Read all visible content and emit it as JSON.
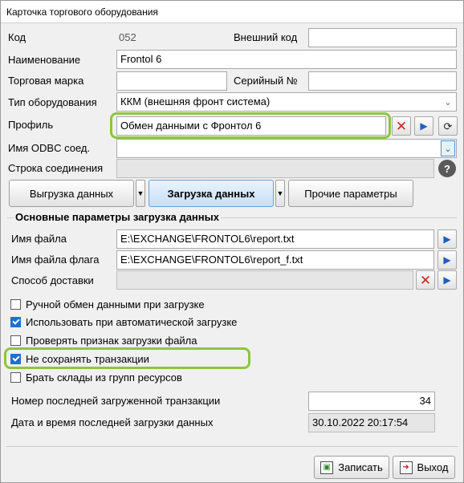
{
  "window": {
    "title": "Карточка торгового оборудования"
  },
  "fields": {
    "code_label": "Код",
    "code_value": "052",
    "external_code_label": "Внешний код",
    "external_code_value": "",
    "name_label": "Наименование",
    "name_value": "Frontol 6",
    "brand_label": "Торговая марка",
    "brand_value": "",
    "serial_label": "Серийный №",
    "serial_value": "",
    "type_label": "Тип оборудования",
    "type_value": "ККМ (внешняя фронт система)",
    "profile_label": "Профиль",
    "profile_value": "Обмен данными с Фронтол 6",
    "odbc_label": "Имя ODBC соед.",
    "odbc_value": "",
    "connection_label": "Строка соединения",
    "connection_value": ""
  },
  "tabs": {
    "export_label": "Выгрузка данных",
    "import_label": "Загрузка данных",
    "other_label": "Прочие параметры"
  },
  "import_group": {
    "title": "Основные параметры загрузка данных",
    "filename_label": "Имя файла",
    "filename_value": "E:\\EXCHANGE\\FRONTOL6\\report.txt",
    "flagfile_label": "Имя файла флага",
    "flagfile_value": "E:\\EXCHANGE\\FRONTOL6\\report_f.txt",
    "delivery_label": "Способ доставки",
    "delivery_value": ""
  },
  "checkboxes": [
    {
      "label": "Ручной обмен данными при загрузке",
      "checked": false
    },
    {
      "label": "Использовать при автоматической загрузке",
      "checked": true
    },
    {
      "label": "Проверять признак загрузки файла",
      "checked": false
    },
    {
      "label": "Не сохранять транзакции",
      "checked": true
    },
    {
      "label": "Брать склады из групп ресурсов",
      "checked": false
    }
  ],
  "status": {
    "last_tx_label": "Номер последней загруженной транзакции",
    "last_tx_value": "34",
    "last_load_label": "Дата и время последней загрузки данных",
    "last_load_value": "30.10.2022 20:17:54"
  },
  "footer": {
    "save_label": "Записать",
    "exit_label": "Выход"
  },
  "icons": {
    "clear": "clear-icon",
    "open": "arrow-right-icon",
    "refresh": "refresh-icon",
    "help": "help-icon",
    "save": "save-icon",
    "exit": "exit-icon"
  },
  "colors": {
    "highlight": "#8cc63f",
    "checkbox_checked": "#1f6fd1",
    "clear_icon": "#d81e1e",
    "arrow_icon": "#1f5fbf"
  }
}
